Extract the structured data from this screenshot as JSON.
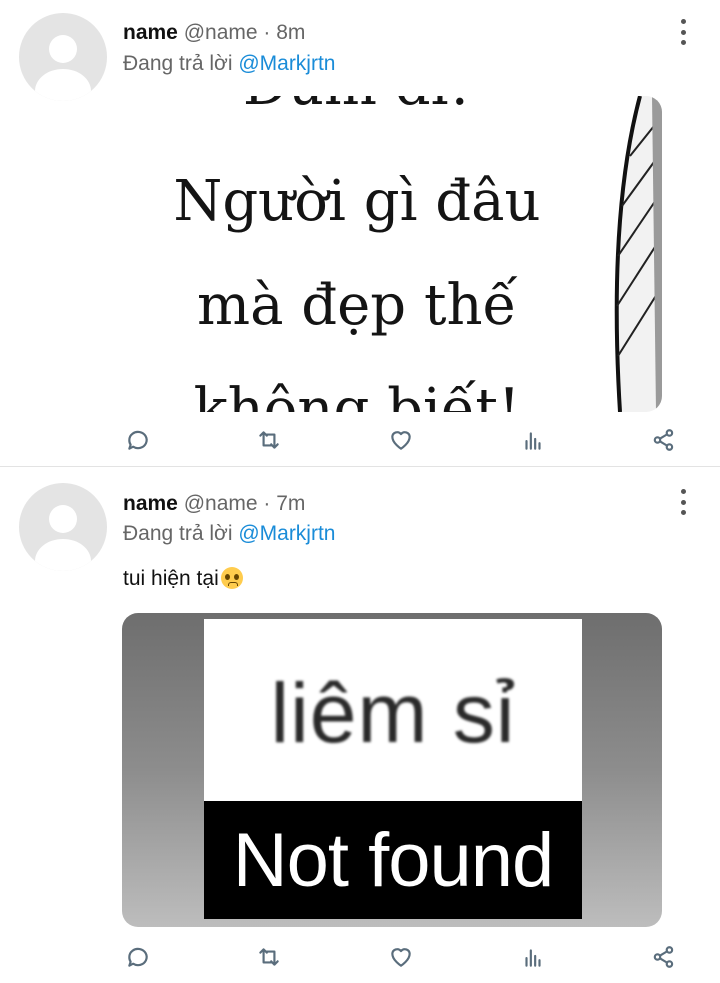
{
  "tweets": [
    {
      "display_name": "name",
      "handle": "@name",
      "time": "· 8m",
      "reply_prefix": "Đang trả lời ",
      "reply_to": "@Markjrtn",
      "media_lines": [
        "Dùm đi!",
        "Người gì đâu",
        "mà đẹp thế",
        "không biết!"
      ]
    },
    {
      "display_name": "name",
      "handle": "@name",
      "time": "· 7m",
      "reply_prefix": "Đang trả lời ",
      "reply_to": "@Markjrtn",
      "text": "tui hiện tại",
      "media_top": "liêm sỉ",
      "media_bottom": "Not found"
    }
  ],
  "icons": {
    "reply": "comment-icon",
    "retweet": "retweet-icon",
    "like": "heart-icon",
    "stats": "stats-icon",
    "share": "share-icon",
    "more": "more-vertical-icon",
    "emoji": "pleading-face-emoji"
  },
  "colors": {
    "mention": "#1a8cd8",
    "icon": "#5a6d7c",
    "avatar": "#e4e4e4"
  }
}
